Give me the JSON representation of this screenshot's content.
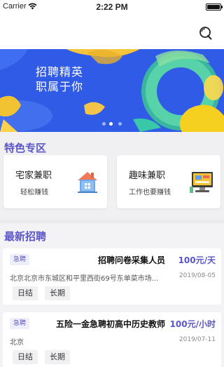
{
  "status_bar": {
    "carrier": "Carrier",
    "time": "2:22 PM"
  },
  "nav": {
    "search_icon": "search-icon"
  },
  "banner": {
    "headline": "招聘精英职属于你",
    "slides": 3,
    "active_slide": 1
  },
  "featured": {
    "title": "特色专区",
    "cards": [
      {
        "title": "宅家兼职",
        "subtitle": "轻松赚钱",
        "icon": "house-icon"
      },
      {
        "title": "趣味兼职",
        "subtitle": "工作也要赚钱",
        "icon": "computer-icon"
      }
    ]
  },
  "latest": {
    "title": "最新招聘",
    "jobs": [
      {
        "badge": "急聘",
        "title": "招聘问卷采集人员",
        "salary": "100元/天",
        "address": "北京北京市东城区和平里西街69号东单菜市场...",
        "date": "2019/08-05",
        "tags": [
          "日结",
          "长期"
        ]
      },
      {
        "badge": "急聘",
        "title": "五险一金急聘初高中历史教师",
        "salary": "100元/小时",
        "address": "北京",
        "date": "2019/07-11",
        "tags": [
          "日结",
          "长期"
        ]
      }
    ]
  },
  "colors": {
    "accent": "#5b55c8",
    "banner_blue": "#2f5be6"
  }
}
